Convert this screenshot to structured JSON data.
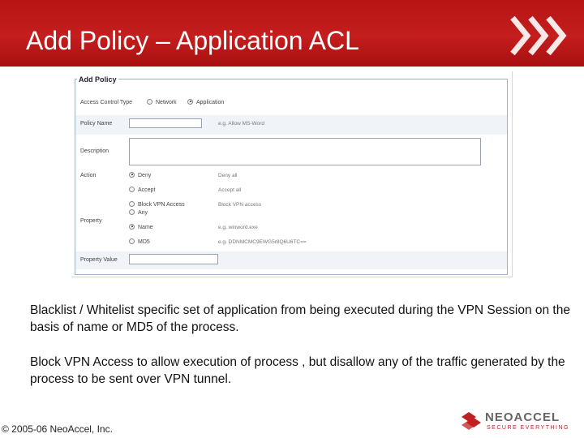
{
  "slide": {
    "title": "Add Policy – Application ACL",
    "paragraphs": [
      "Blacklist / Whitelist specific set of application from being executed during the VPN Session on the basis of name or MD5 of the process.",
      "Block VPN Access to allow execution of process , but disallow any of the traffic generated by the process to be sent over VPN tunnel."
    ],
    "copyright": "© 2005-06 NeoAccel, Inc.",
    "brand": {
      "name": "NeoAccel",
      "tagline": "Secure Everything"
    },
    "colors": {
      "header": "#c41e1e",
      "accent": "#c02020"
    }
  },
  "form": {
    "legend": "Add Policy",
    "access_control_type": {
      "label": "Access Control Type",
      "options": [
        "Network",
        "Application"
      ],
      "selected": "Application"
    },
    "policy_name": {
      "label": "Policy Name",
      "value": "",
      "hint": "e.g. Allow MS-Word"
    },
    "description": {
      "label": "Description",
      "value": ""
    },
    "action": {
      "label": "Action",
      "options": [
        {
          "label": "Deny",
          "hint": "Deny all",
          "selected": true
        },
        {
          "label": "Accept",
          "hint": "Accept all",
          "selected": false
        },
        {
          "label": "Block VPN Access",
          "hint": "Block VPN access",
          "selected": false
        }
      ]
    },
    "property": {
      "label": "Property",
      "options": [
        {
          "label": "Any",
          "hint": "",
          "selected": false
        },
        {
          "label": "Name",
          "hint": "e.g. winword.exe",
          "selected": true
        },
        {
          "label": "MD5",
          "hint": "e.g. DDNMCMC9EWG5r8Q6U6TC==",
          "selected": false
        }
      ]
    },
    "property_value": {
      "label": "Property Value",
      "value": ""
    }
  }
}
